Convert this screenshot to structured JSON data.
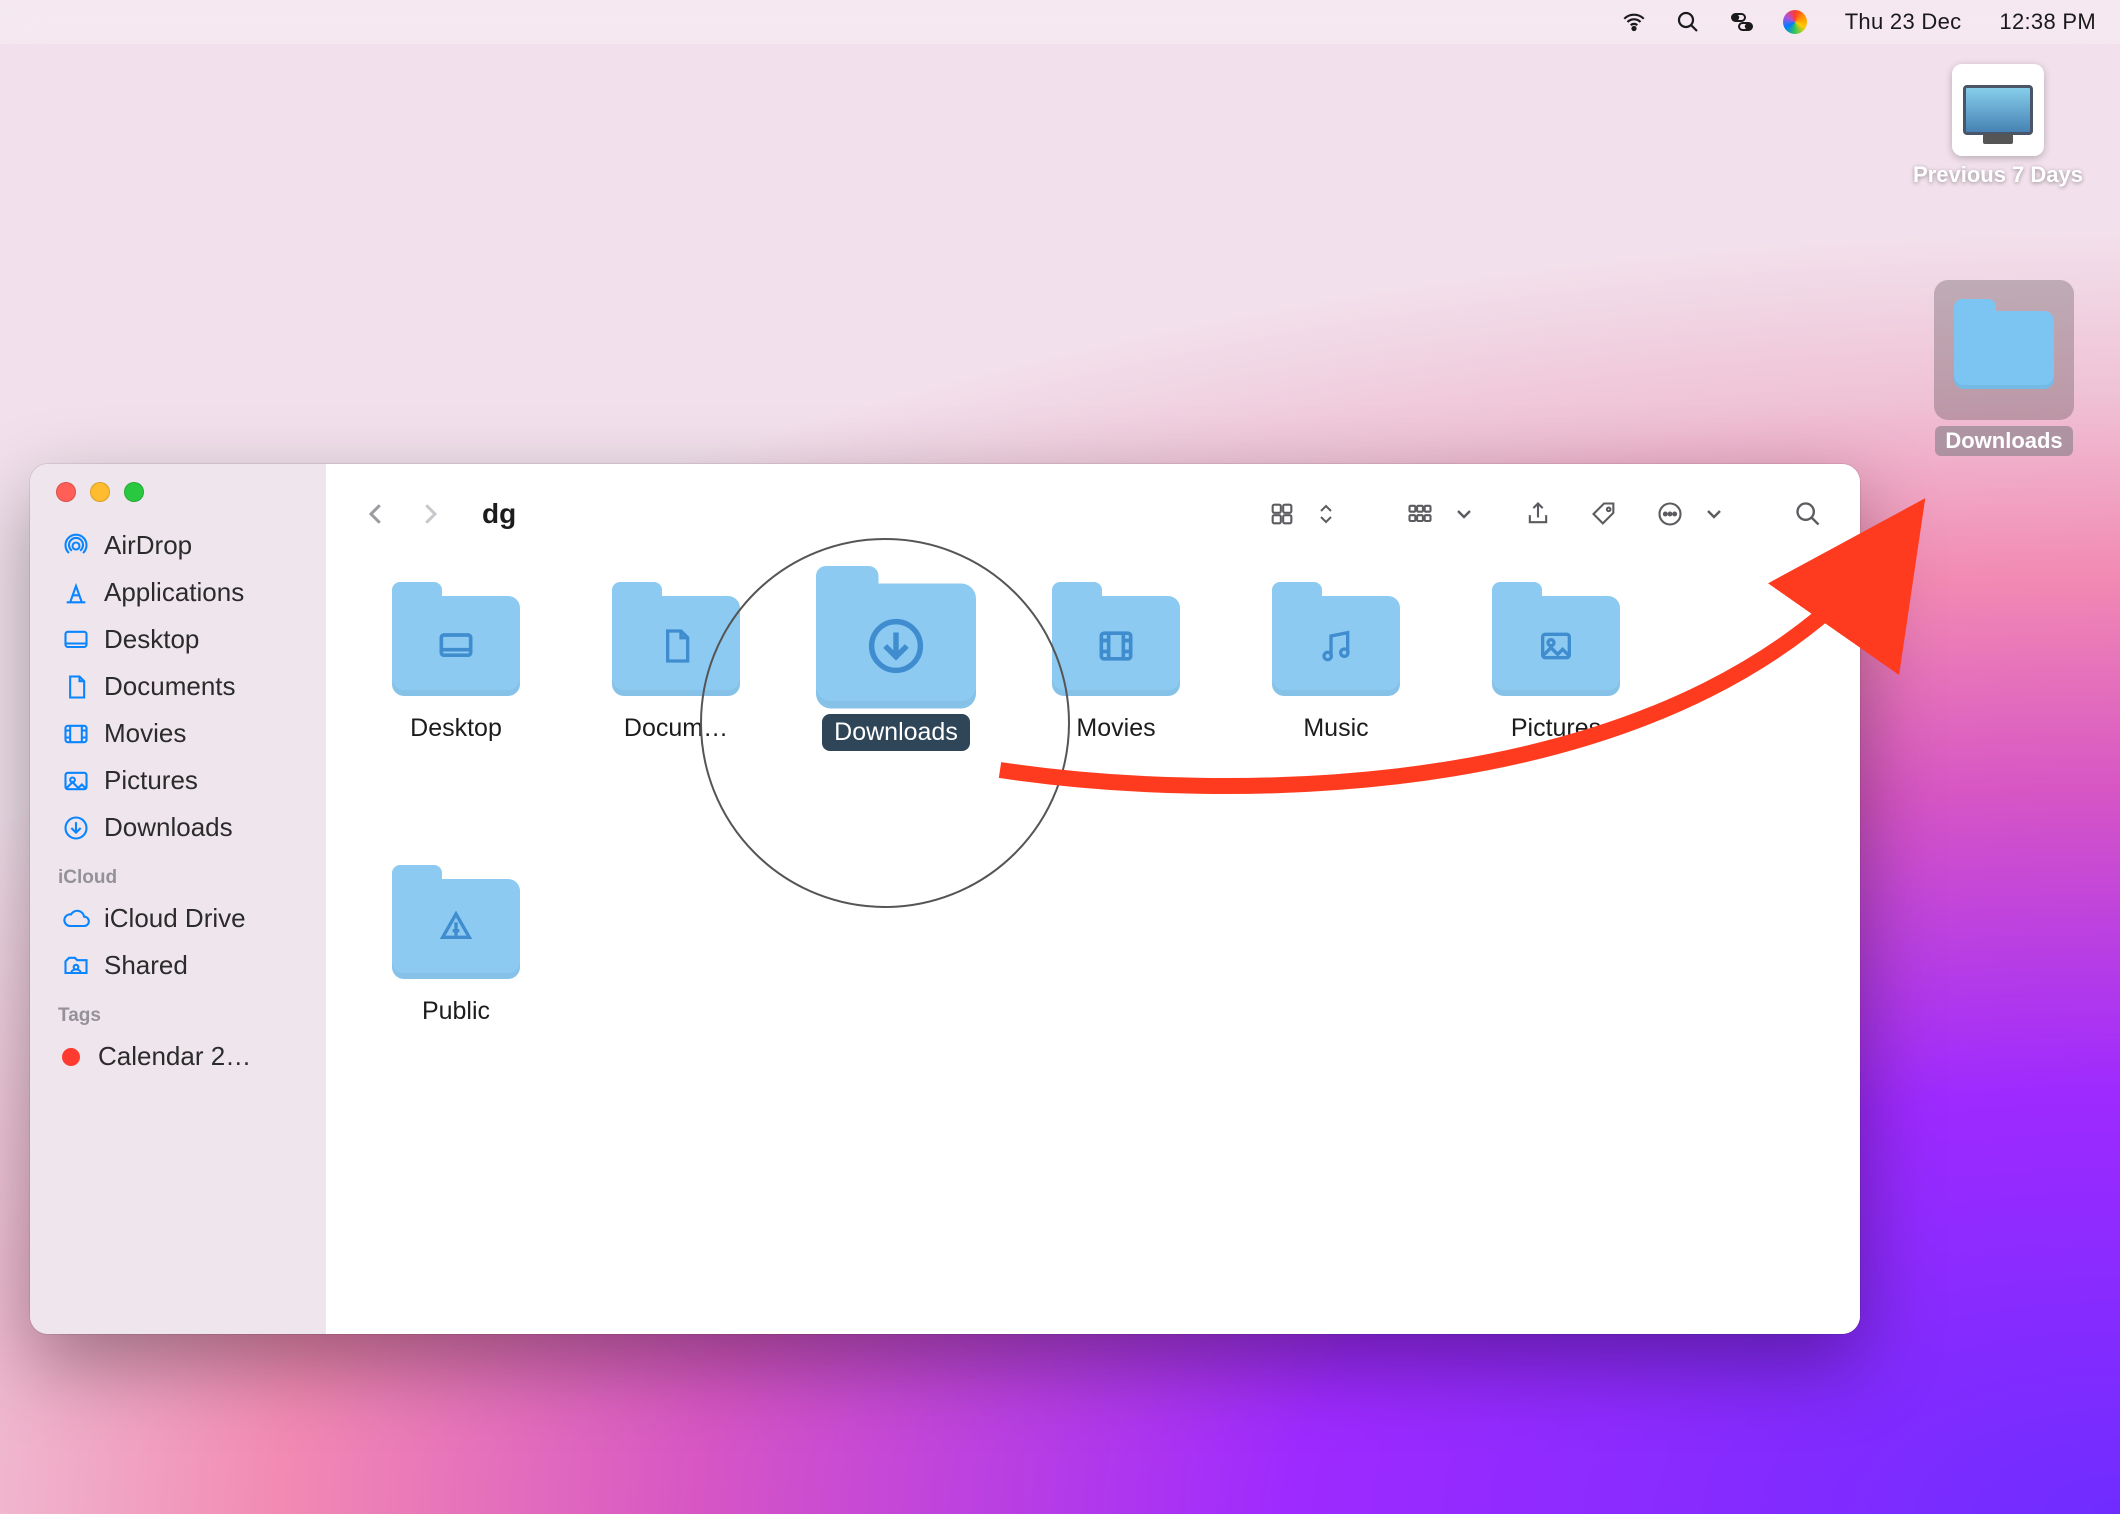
{
  "menubar": {
    "date": "Thu 23 Dec",
    "time": "12:38 PM"
  },
  "desktop_items": {
    "previous7days": "Previous 7 Days",
    "downloads_alias": "Downloads"
  },
  "finder": {
    "window_title": "dg",
    "sidebar": {
      "favorites_heading": "",
      "items": {
        "airdrop": "AirDrop",
        "applications": "Applications",
        "desktop": "Desktop",
        "documents": "Documents",
        "movies": "Movies",
        "pictures": "Pictures",
        "downloads": "Downloads"
      },
      "icloud_heading": "iCloud",
      "icloud_items": {
        "icloud_drive": "iCloud Drive",
        "shared": "Shared"
      },
      "tags_heading": "Tags",
      "tags": {
        "calendar": "Calendar 2…"
      }
    },
    "folders": {
      "desktop": "Desktop",
      "documents": "Docum…",
      "downloads": "Downloads",
      "movies": "Movies",
      "music": "Music",
      "pictures": "Pictures",
      "public": "Public"
    }
  },
  "annotation": {
    "arrow_color": "#ff3b1f"
  }
}
